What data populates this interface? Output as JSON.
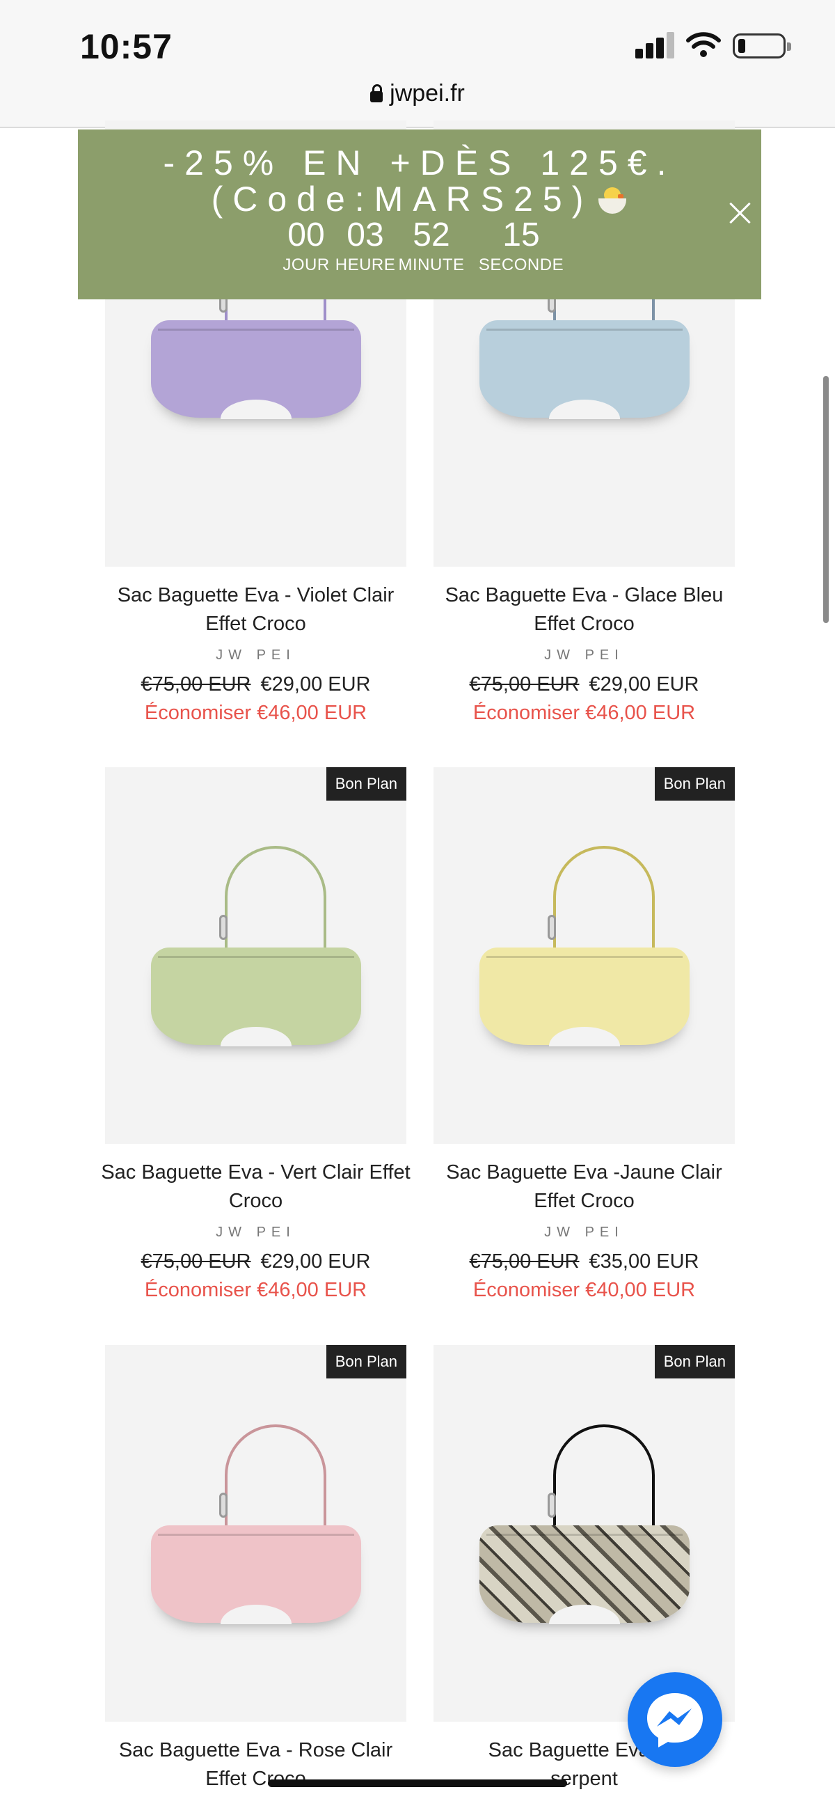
{
  "status_bar": {
    "time": "10:57"
  },
  "browser": {
    "url": "jwpei.fr"
  },
  "promo": {
    "line1": "-25% EN +DÈS 125€.",
    "line2": "(Code:MARS25)",
    "countdown": [
      {
        "value": "00",
        "label": "JOUR"
      },
      {
        "value": "03",
        "label": "HEURE"
      },
      {
        "value": "52",
        "label": "MINUTE"
      },
      {
        "value": "15",
        "label": "SECONDE"
      }
    ]
  },
  "products": [
    {
      "title": "Sac Baguette Eva - Violet Clair Effet Croco",
      "brand": "JW PEI",
      "old_price": "€75,00 EUR",
      "price": "€29,00 EUR",
      "savings": "Économiser €46,00 EUR",
      "badge": "",
      "color": "#b3a4d6"
    },
    {
      "title": "Sac Baguette Eva - Glace Bleu Effet Croco",
      "brand": "JW PEI",
      "old_price": "€75,00 EUR",
      "price": "€29,00 EUR",
      "savings": "Économiser €46,00 EUR",
      "badge": "",
      "color": "#b8cfdc"
    },
    {
      "title": "Sac Baguette Eva - Vert Clair Effet Croco",
      "brand": "JW PEI",
      "old_price": "€75,00 EUR",
      "price": "€29,00 EUR",
      "savings": "Économiser €46,00 EUR",
      "badge": "Bon Plan",
      "color": "#c5d4a2"
    },
    {
      "title": "Sac Baguette Eva -Jaune Clair Effet Croco",
      "brand": "JW PEI",
      "old_price": "€75,00 EUR",
      "price": "€35,00 EUR",
      "savings": "Économiser €40,00 EUR",
      "badge": "Bon Plan",
      "color": "#f0e8a6"
    },
    {
      "title": "Sac Baguette Eva - Rose Clair Effet Croco",
      "brand": "",
      "old_price": "",
      "price": "",
      "savings": "",
      "badge": "Bon Plan",
      "color": "#efc3c8"
    },
    {
      "title": "Sac Baguette Eva - F",
      "title_line2": "serpent",
      "brand": "",
      "old_price": "",
      "price": "",
      "savings": "",
      "badge": "Bon Plan",
      "color": "#a9a596"
    }
  ],
  "colors": {
    "promo_bg": "#8c9e6b",
    "savings": "#e8534b",
    "messenger": "#1877f2"
  },
  "icons": {
    "lock": "lock-icon",
    "close": "close-icon",
    "messenger": "messenger-icon"
  }
}
